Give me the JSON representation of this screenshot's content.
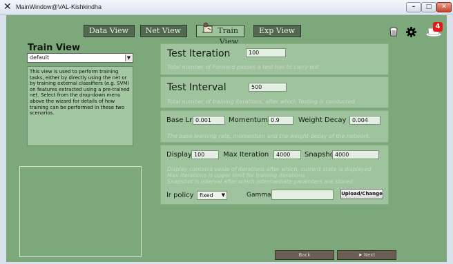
{
  "window": {
    "title": "MainWindow@VAL-Kishkindha"
  },
  "nav": {
    "data_view": "Data View",
    "net_view": "Net View",
    "train_view": "Train View",
    "exp_view": "Exp View"
  },
  "notifications": {
    "count": "4"
  },
  "left_panel": {
    "title": "Train View",
    "preset_value": "default",
    "description": "This view is used to perform training tasks, either by directly using the net or by training external classifiers (e.g. SVM) on features extracted using a pre-trained net. Select from the drop-down menu above the wizard for details of how training can be performed in these two scenarios."
  },
  "test_iteration": {
    "label": "Test Iteration",
    "value": "100",
    "hint": "Total number of Forward passes a test has to carry out"
  },
  "test_interval": {
    "label": "Test Interval",
    "value": "500",
    "hint": "Total number of training iterations, after which Testing is conducted"
  },
  "learning": {
    "base_lr_label": "Base Lr",
    "base_lr_value": "0.001",
    "momentum_label": "Momentum",
    "momentum_value": "0.9",
    "weight_decay_label": "Weight Decay",
    "weight_decay_value": "0.004",
    "hint": "The base learning rate, momentum and the weight decay of the network."
  },
  "iterations": {
    "display_label": "Display",
    "display_value": "100",
    "max_iter_label": "Max Iteration",
    "max_iter_value": "4000",
    "snapshot_label": "Snapshot",
    "snapshot_value": "4000",
    "hint_line1": "Display contains value of iterations after which, current state is displayed",
    "hint_line2": "Max Iterations  is upper limit for training iterations",
    "hint_line3": "Snapshot is interval after which intermediate paramters are stored",
    "lr_policy_label": "lr policy",
    "lr_policy_value": "fixed",
    "gamma_label": "Gamma",
    "gamma_value": "",
    "upload_label": "Upload/Change"
  },
  "footer": {
    "back_label": "Back",
    "next_label": "Next"
  },
  "colors": {
    "background": "#7da87b",
    "panel": "#9fc39c",
    "nav_dark": "#4f6a4e",
    "badge": "#e81818"
  }
}
